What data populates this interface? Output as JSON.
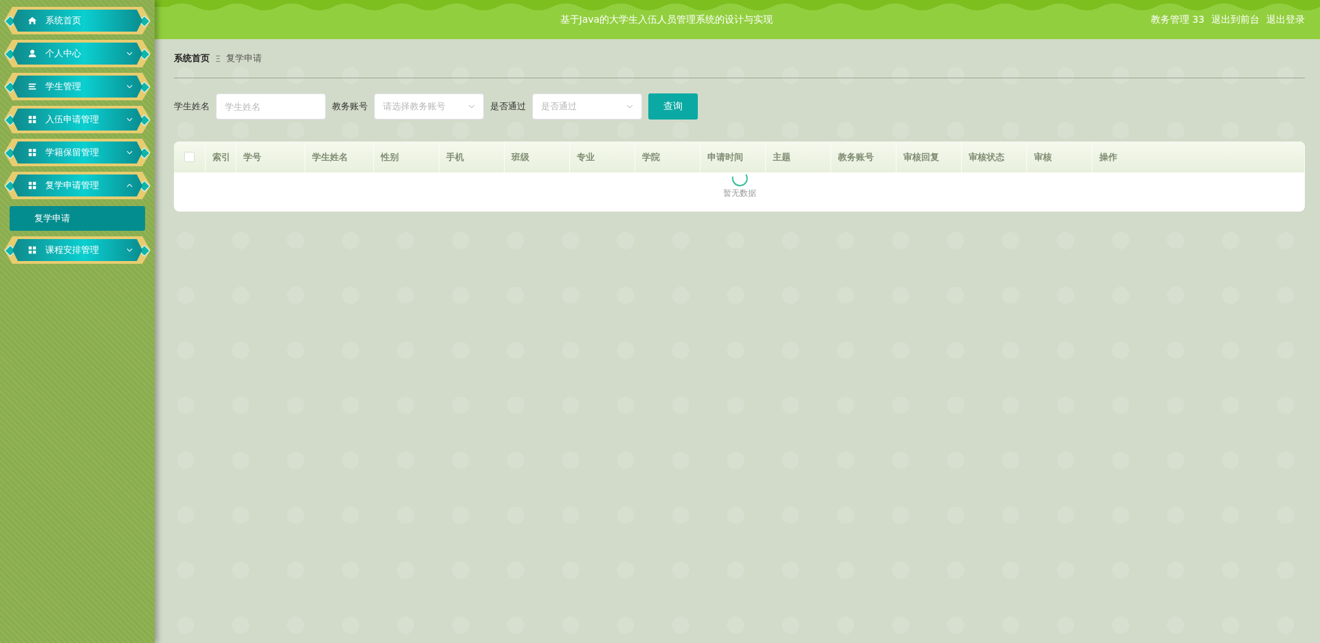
{
  "sidebar": {
    "items": [
      {
        "label": "系统首页",
        "kind": "link"
      },
      {
        "label": "个人中心",
        "kind": "menu",
        "expanded": false
      },
      {
        "label": "学生管理",
        "kind": "menu",
        "expanded": false
      },
      {
        "label": "入伍申请管理",
        "kind": "menu",
        "expanded": false
      },
      {
        "label": "学籍保留管理",
        "kind": "menu",
        "expanded": false
      },
      {
        "label": "复学申请管理",
        "kind": "menu",
        "expanded": true,
        "children": [
          {
            "label": "复学申请",
            "selected": true
          }
        ]
      },
      {
        "label": "课程安排管理",
        "kind": "menu",
        "expanded": false
      }
    ]
  },
  "header": {
    "title": "基于Java的大学生入伍人员管理系统的设计与实现",
    "user": "教务管理 33",
    "links": [
      "退出到前台",
      "退出登录"
    ]
  },
  "breadcrumb": {
    "items": [
      "系统首页",
      "复学申请"
    ],
    "separator": "Ξ"
  },
  "search": {
    "fields": [
      {
        "label": "学生姓名",
        "kind": "input",
        "placeholder": "学生姓名"
      },
      {
        "label": "教务账号",
        "kind": "select",
        "placeholder": "请选择教务账号"
      },
      {
        "label": "是否通过",
        "kind": "select",
        "placeholder": "是否通过"
      }
    ],
    "button": "查询"
  },
  "table": {
    "columns": [
      "索引",
      "学号",
      "学生姓名",
      "性别",
      "手机",
      "班级",
      "专业",
      "学院",
      "申请时间",
      "主题",
      "教务账号",
      "审核回复",
      "审核状态",
      "审核",
      "操作"
    ],
    "select_all_checked": false,
    "loading": true,
    "empty_text": "暂无数据"
  }
}
